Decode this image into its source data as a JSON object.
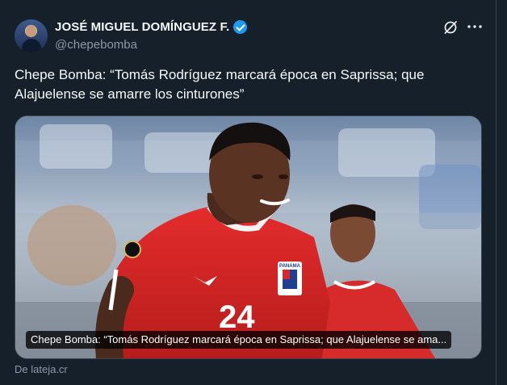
{
  "author": {
    "display_name": "JOSÉ MIGUEL DOMÍNGUEZ F.",
    "handle": "@chepebomba",
    "verified": true
  },
  "tweet": {
    "text": "Chepe Bomba: “Tomás Rodríguez marcará época en Saprissa; que Alajuelense se amarre los cinturones”"
  },
  "card": {
    "caption": "Chepe Bomba: “Tomás Rodríguez marcará época en Saprissa; que Alajuelense se ama...",
    "source": "De lateja.cr",
    "jersey_badge": "PANAMA",
    "jersey_number": "24"
  },
  "icons": {
    "verified": "verified-badge-icon",
    "grok": "grok-icon",
    "more": "more-options-icon"
  },
  "colors": {
    "background": "#15202b",
    "accent": "#1d9bf0",
    "muted_text": "#8b98a5"
  }
}
